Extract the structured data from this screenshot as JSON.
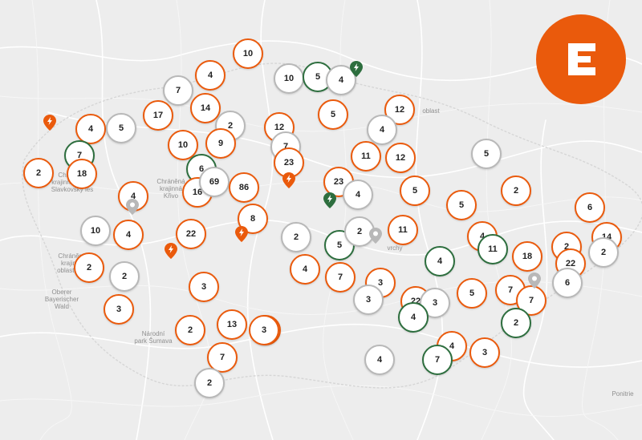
{
  "map": {
    "colors": {
      "orange": "#ea5a0c",
      "green": "#2d6e3e",
      "gray": "#b8b8b8",
      "background": "#ededed",
      "roads": "#ffffff",
      "borders": "#d9d9d9"
    },
    "labels": [
      {
        "id": "slavkovsky",
        "text": "Slavkovský les",
        "lines": [
          "Chráněná",
          "krajinná oblast",
          "Slavkovský les"
        ]
      },
      {
        "id": "krivoklatsko",
        "text": "Chráněná krajinná oblast Křivoklátsko",
        "lines": [
          "Chráněná",
          "krajinná",
          "Křivo"
        ]
      },
      {
        "id": "cesky-les",
        "text": "Chráněná krajinná oblast Český les",
        "lines": [
          "Chráněná",
          "krajinná",
          "oblast Čes"
        ]
      },
      {
        "id": "oberer-wald",
        "text": "Oberer Bayerischer Wald",
        "lines": [
          "Oberer",
          "Bayerischer",
          "Wald"
        ]
      },
      {
        "id": "sumava",
        "text": "Národní park Šumava",
        "lines": [
          "Národní",
          "park Šumava"
        ]
      },
      {
        "id": "vrchy",
        "text": "vrchy",
        "lines": [
          "vrchy"
        ]
      },
      {
        "id": "poohri",
        "text": "oblast",
        "lines": [
          "oblast"
        ]
      },
      {
        "id": "ponitrie",
        "text": "Ponitrie",
        "lines": [
          "Ponitrie"
        ]
      }
    ],
    "clusters": [
      {
        "count": "10",
        "status": "orange"
      },
      {
        "count": "4",
        "status": "orange"
      },
      {
        "count": "7",
        "status": "gray"
      },
      {
        "count": "10",
        "status": "gray"
      },
      {
        "count": "5",
        "status": "green"
      },
      {
        "count": "4",
        "status": "gray"
      },
      {
        "count": "17",
        "status": "orange"
      },
      {
        "count": "14",
        "status": "orange"
      },
      {
        "count": "4",
        "status": "orange"
      },
      {
        "count": "5",
        "status": "gray"
      },
      {
        "count": "2",
        "status": "gray"
      },
      {
        "count": "12",
        "status": "orange"
      },
      {
        "count": "5",
        "status": "orange"
      },
      {
        "count": "12",
        "status": "orange"
      },
      {
        "count": "4",
        "status": "gray"
      },
      {
        "count": "10",
        "status": "orange"
      },
      {
        "count": "9",
        "status": "orange"
      },
      {
        "count": "7",
        "status": "gray"
      },
      {
        "count": "7",
        "status": "green"
      },
      {
        "count": "2",
        "status": "orange"
      },
      {
        "count": "18",
        "status": "orange"
      },
      {
        "count": "6",
        "status": "green"
      },
      {
        "count": "23",
        "status": "orange"
      },
      {
        "count": "11",
        "status": "orange"
      },
      {
        "count": "12",
        "status": "orange"
      },
      {
        "count": "5",
        "status": "gray"
      },
      {
        "count": "4",
        "status": "orange"
      },
      {
        "count": "16",
        "status": "orange"
      },
      {
        "count": "69",
        "status": "gray"
      },
      {
        "count": "86",
        "status": "orange"
      },
      {
        "count": "23",
        "status": "orange"
      },
      {
        "count": "4",
        "status": "gray"
      },
      {
        "count": "5",
        "status": "orange"
      },
      {
        "count": "2",
        "status": "orange"
      },
      {
        "count": "5",
        "status": "orange"
      },
      {
        "count": "6",
        "status": "orange"
      },
      {
        "count": "10",
        "status": "gray"
      },
      {
        "count": "4",
        "status": "orange"
      },
      {
        "count": "22",
        "status": "orange"
      },
      {
        "count": "8",
        "status": "orange"
      },
      {
        "count": "2",
        "status": "gray"
      },
      {
        "count": "5",
        "status": "green"
      },
      {
        "count": "2",
        "status": "gray"
      },
      {
        "count": "11",
        "status": "orange"
      },
      {
        "count": "4",
        "status": "orange"
      },
      {
        "count": "11",
        "status": "green"
      },
      {
        "count": "18",
        "status": "orange"
      },
      {
        "count": "2",
        "status": "orange"
      },
      {
        "count": "14",
        "status": "orange"
      },
      {
        "count": "22",
        "status": "orange"
      },
      {
        "count": "2",
        "status": "orange"
      },
      {
        "count": "2",
        "status": "gray"
      },
      {
        "count": "4",
        "status": "orange"
      },
      {
        "count": "7",
        "status": "orange"
      },
      {
        "count": "4",
        "status": "green"
      },
      {
        "count": "2",
        "status": "gray"
      },
      {
        "count": "6",
        "status": "gray"
      },
      {
        "count": "3",
        "status": "orange"
      },
      {
        "count": "7",
        "status": "orange"
      },
      {
        "count": "3",
        "status": "gray"
      },
      {
        "count": "22",
        "status": "orange"
      },
      {
        "count": "3",
        "status": "gray"
      },
      {
        "count": "5",
        "status": "orange"
      },
      {
        "count": "7",
        "status": "orange"
      },
      {
        "count": "2",
        "status": "green"
      },
      {
        "count": "3",
        "status": "orange"
      },
      {
        "count": "3",
        "status": "orange"
      },
      {
        "count": "4",
        "status": "green"
      },
      {
        "count": "2",
        "status": "orange"
      },
      {
        "count": "13",
        "status": "orange"
      },
      {
        "count": "5",
        "status": "orange"
      },
      {
        "count": "7",
        "status": "orange"
      },
      {
        "count": "4",
        "status": "gray"
      },
      {
        "count": "2",
        "status": "gray"
      },
      {
        "count": "4",
        "status": "orange"
      },
      {
        "count": "7",
        "status": "green"
      },
      {
        "count": "3",
        "status": "orange"
      },
      {
        "count": "3",
        "status": "orange"
      }
    ],
    "pins": [
      {
        "status": "orange",
        "icon": "bolt-icon"
      },
      {
        "status": "green",
        "icon": "bolt-icon"
      },
      {
        "status": "orange",
        "icon": "bolt-icon"
      },
      {
        "status": "green",
        "icon": "bolt-icon"
      },
      {
        "status": "orange",
        "icon": "bolt-icon"
      },
      {
        "status": "orange",
        "icon": "bolt-icon"
      },
      {
        "status": "gray",
        "icon": "pin-icon"
      },
      {
        "status": "gray",
        "icon": "pin-icon"
      },
      {
        "status": "gray",
        "icon": "pin-icon"
      }
    ]
  },
  "logo": {
    "brand": "CEZ",
    "icon": "cez-logo-icon",
    "color": "#ea5a0c"
  }
}
